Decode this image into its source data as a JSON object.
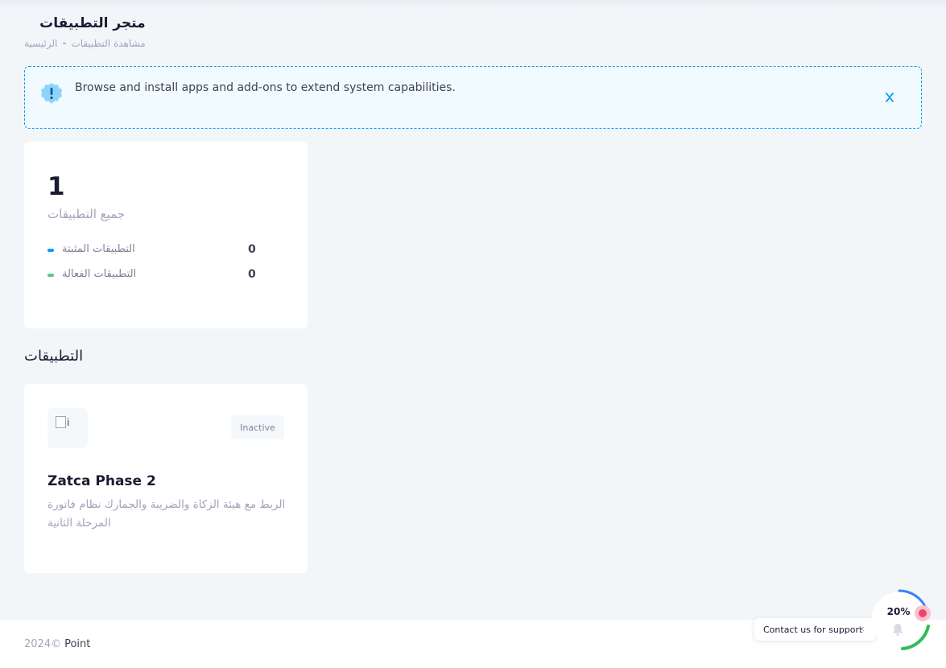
{
  "header": {
    "title": "متجر التطبيقات",
    "breadcrumb": [
      "الرئيسية",
      "مشاهدة التطبيقات"
    ]
  },
  "notice": {
    "text": "Browse and install apps and add-ons to extend system capabilities.",
    "icon": "exclamation-icon",
    "color": "#009ef7"
  },
  "stats": {
    "total": "1",
    "total_label": "جميع التطبيقات",
    "rows": [
      {
        "label": "التطبيقات المثبتة",
        "value": "0",
        "color": "#009ef7"
      },
      {
        "label": "التطبيقات الفعالة",
        "value": "0",
        "color": "#50cd89"
      }
    ]
  },
  "apps_section": {
    "title": "التطبيقات",
    "apps": [
      {
        "logo_alt": "i",
        "status": "Inactive",
        "name": "Zatca Phase 2",
        "description": "الربط مع هيئة الزكاة والضريبة والجمارك نظام فاتورة المرحلة الثانية"
      }
    ]
  },
  "footer": {
    "copyright": "2024©",
    "brand": "Point"
  },
  "support": {
    "label": "Contact us for support",
    "close": "×"
  },
  "progress": {
    "label": "20%",
    "value": 20
  }
}
